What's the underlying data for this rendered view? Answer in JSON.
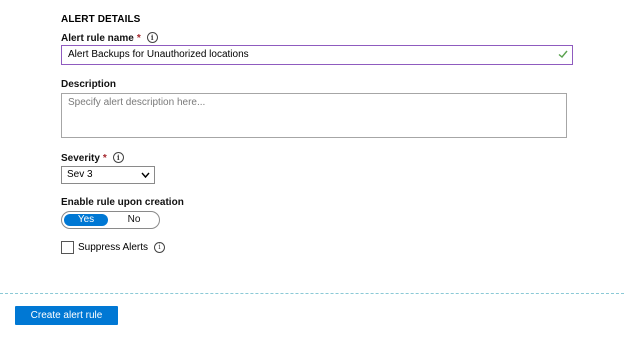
{
  "section": {
    "title": "ALERT DETAILS"
  },
  "rule_name": {
    "label": "Alert rule name",
    "required_mark": "*",
    "info_icon": "info-icon",
    "value": "Alert Backups for Unauthorized locations",
    "valid_icon": "checkmark-icon",
    "valid_color": "#5aa24f",
    "focus_border_color": "#8f5bbf"
  },
  "description": {
    "label": "Description",
    "placeholder": "Specify alert description here..."
  },
  "severity": {
    "label": "Severity",
    "required_mark": "*",
    "info_icon": "info-icon",
    "selected": "Sev 3",
    "dropdown_icon": "chevron-down-icon"
  },
  "enable_rule": {
    "label": "Enable rule upon creation",
    "options": [
      "Yes",
      "No"
    ],
    "selected": "Yes",
    "accent": "#0078d4"
  },
  "suppress_alerts": {
    "label": "Suppress Alerts",
    "checked": false,
    "info_icon": "info-icon"
  },
  "actions": {
    "create_label": "Create alert rule",
    "create_color": "#0078d4"
  }
}
